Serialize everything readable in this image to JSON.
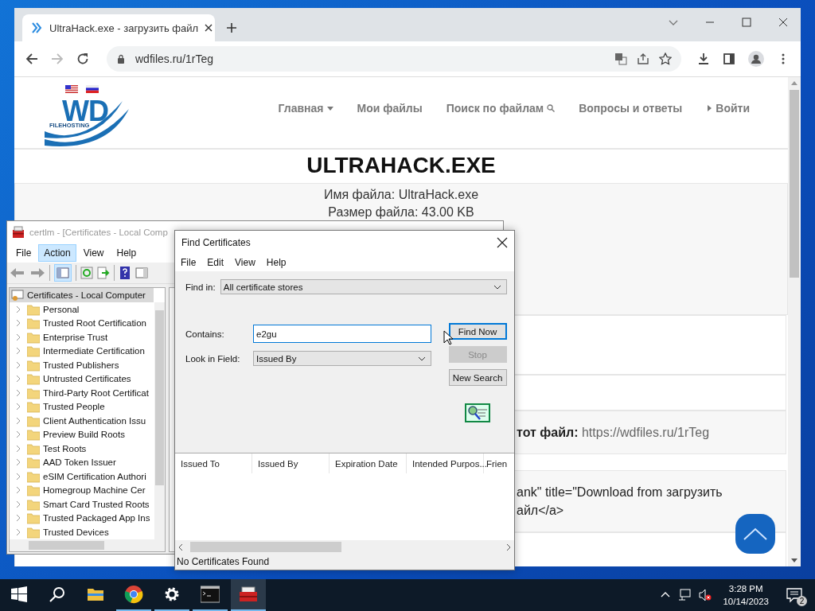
{
  "browser": {
    "tab_title": "UltraHack.exe - загрузить файл",
    "url": "wdfiles.ru/1rTeg"
  },
  "site": {
    "logo_text": "WD",
    "logo_subtext": "FILEHOSTING",
    "nav": [
      {
        "label": "Главная",
        "kind": "dropdown"
      },
      {
        "label": "Мои файлы",
        "kind": "plain"
      },
      {
        "label": "Поиск по файлам",
        "kind": "search"
      },
      {
        "label": "Вопросы и ответы",
        "kind": "plain"
      },
      {
        "label": "Войти",
        "kind": "login"
      }
    ],
    "title": "ULTRAHACK.EXE",
    "file_info": [
      {
        "label": "Имя файла:",
        "value": "UltraHack.exe"
      },
      {
        "label": "Размер файла:",
        "value": "43.00 KB"
      }
    ],
    "link_row": {
      "label": "тот файл:",
      "value": "https://wdfiles.ru/1rTeg"
    },
    "code_lines": [
      "ank\" title=\"Download from загрузить",
      "айл</a>"
    ]
  },
  "certlm": {
    "title": "certlm - [Certificates - Local Comp",
    "menu": [
      {
        "label": "File",
        "selected": false
      },
      {
        "label": "Action",
        "selected": true
      },
      {
        "label": "View",
        "selected": false
      },
      {
        "label": "Help",
        "selected": false
      }
    ],
    "tree": {
      "label": "Certificates - Local Computer",
      "selected": true,
      "children": [
        {
          "label": "Personal",
          "selected": false
        },
        {
          "label": "Trusted Root Certification",
          "selected": false
        },
        {
          "label": "Enterprise Trust",
          "selected": false
        },
        {
          "label": "Intermediate Certification",
          "selected": false
        },
        {
          "label": "Trusted Publishers",
          "selected": false
        },
        {
          "label": "Untrusted Certificates",
          "selected": false
        },
        {
          "label": "Third-Party Root Certificat",
          "selected": false
        },
        {
          "label": "Trusted People",
          "selected": false
        },
        {
          "label": "Client Authentication Issu",
          "selected": false
        },
        {
          "label": "Preview Build Roots",
          "selected": false
        },
        {
          "label": "Test Roots",
          "selected": false
        },
        {
          "label": "AAD Token Issuer",
          "selected": false
        },
        {
          "label": "eSIM Certification Authori",
          "selected": false
        },
        {
          "label": "Homegroup Machine Cer",
          "selected": false
        },
        {
          "label": "Smart Card Trusted Roots",
          "selected": false
        },
        {
          "label": "Trusted Packaged App Ins",
          "selected": false
        },
        {
          "label": "Trusted Devices",
          "selected": false
        }
      ]
    }
  },
  "find_dialog": {
    "title": "Find Certificates",
    "menu": [
      "File",
      "Edit",
      "View",
      "Help"
    ],
    "find_in": {
      "label": "Find in:",
      "value": "All certificate stores"
    },
    "contains": {
      "label": "Contains:",
      "value": "e2gu"
    },
    "look_in_field": {
      "label": "Look in Field:",
      "value": "Issued By"
    },
    "buttons": [
      {
        "label": "Find Now",
        "disabled": false,
        "focused": true
      },
      {
        "label": "Stop",
        "disabled": true,
        "focused": false
      },
      {
        "label": "New Search",
        "disabled": false,
        "focused": false
      }
    ],
    "columns": [
      "Issued To",
      "Issued By",
      "Expiration Date",
      "Intended Purpos...",
      "Frien"
    ],
    "status": "No Certificates Found"
  },
  "taskbar": {
    "apps": [
      {
        "kind": "start",
        "running": false,
        "selected": false
      },
      {
        "kind": "search",
        "running": false,
        "selected": false
      },
      {
        "kind": "files",
        "running": false,
        "selected": false
      },
      {
        "kind": "browser",
        "running": true,
        "selected": false
      },
      {
        "kind": "settings",
        "running": true,
        "selected": false
      },
      {
        "kind": "terminal",
        "running": true,
        "selected": false
      },
      {
        "kind": "certlm",
        "running": true,
        "selected": true
      }
    ],
    "time": "3:28 PM",
    "date": "10/14/2023",
    "notifications": "2"
  }
}
